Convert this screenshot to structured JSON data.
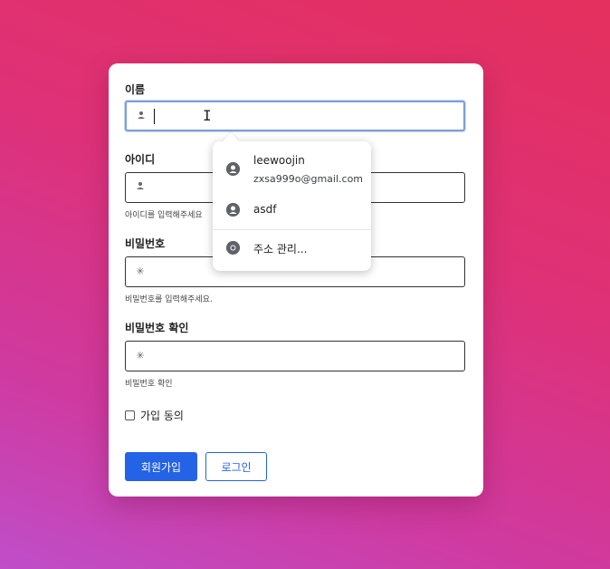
{
  "form": {
    "name": {
      "label": "이름",
      "icon": "person-icon"
    },
    "id": {
      "label": "아이디",
      "hint": "아이디를 입력해주세요",
      "icon": "person-icon"
    },
    "password": {
      "label": "비밀번호",
      "hint": "비밀번호를 입력해주세요.",
      "icon": "asterisk-icon"
    },
    "password_confirm": {
      "label": "비밀번호 확인",
      "hint": "비밀번호 확인",
      "icon": "asterisk-icon"
    },
    "agree_label": "가입 동의",
    "signup_button": "회원가입",
    "login_button": "로그인"
  },
  "autofill": {
    "suggestions": [
      {
        "name": "leewoojin",
        "detail": "zxsa999o@gmail.com",
        "icon": "account-circle-icon"
      },
      {
        "name": "asdf",
        "icon": "account-circle-icon"
      }
    ],
    "manage_label": "주소 관리...",
    "manage_icon": "chrome-icon"
  },
  "colors": {
    "accent": "#2463e6",
    "focus_border": "#7e9ed9"
  }
}
